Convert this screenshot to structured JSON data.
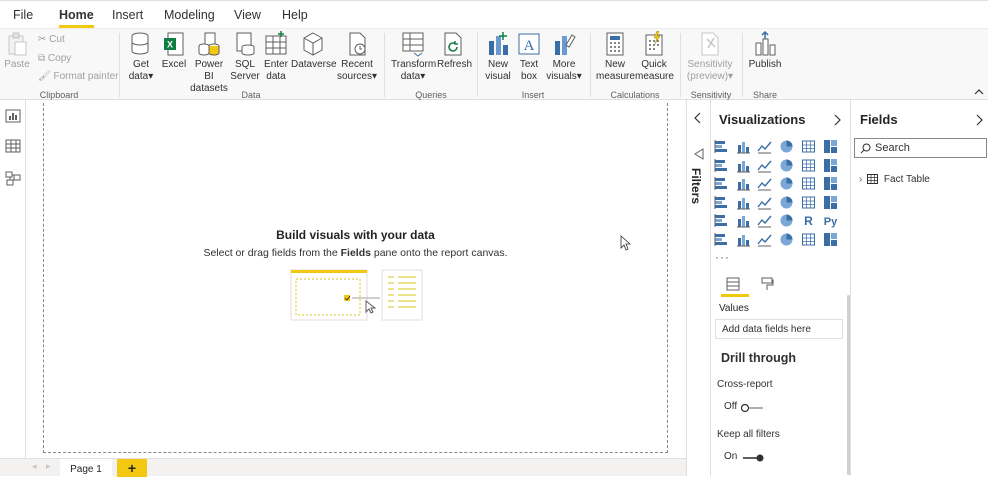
{
  "menu": {
    "items": [
      "File",
      "Home",
      "Insert",
      "Modeling",
      "View",
      "Help"
    ],
    "active": "Home"
  },
  "ribbon": {
    "clipboard": {
      "paste": "Paste",
      "cut": "Cut",
      "copy": "Copy",
      "format_painter": "Format painter",
      "group_label": "Clipboard"
    },
    "data": {
      "get_data_1": "Get",
      "get_data_2": "data",
      "excel": "Excel",
      "powerbi_1": "Power BI",
      "powerbi_2": "datasets",
      "sql_1": "SQL",
      "sql_2": "Server",
      "enter_1": "Enter",
      "enter_2": "data",
      "dataverse": "Dataverse",
      "recent_1": "Recent",
      "recent_2": "sources",
      "group_label": "Data"
    },
    "queries": {
      "transform_1": "Transform",
      "transform_2": "data",
      "refresh": "Refresh",
      "group_label": "Queries"
    },
    "insert": {
      "new_visual_1": "New",
      "new_visual_2": "visual",
      "text_box_1": "Text",
      "text_box_2": "box",
      "more_visuals_1": "More",
      "more_visuals_2": "visuals",
      "group_label": "Insert"
    },
    "calculations": {
      "new_measure_1": "New",
      "new_measure_2": "measure",
      "quick_measure_1": "Quick",
      "quick_measure_2": "measure",
      "group_label": "Calculations"
    },
    "sensitivity": {
      "label_1": "Sensitivity",
      "label_2": "(preview)",
      "group_label": "Sensitivity"
    },
    "share": {
      "publish": "Publish",
      "group_label": "Share"
    }
  },
  "canvas": {
    "title": "Build visuals with your data",
    "subtitle_pre": "Select or drag fields from the ",
    "subtitle_bold": "Fields",
    "subtitle_post": " pane onto the report canvas."
  },
  "pages": {
    "page1": "Page 1",
    "add": "+"
  },
  "filters": {
    "label": "Filters"
  },
  "visualizations": {
    "title": "Visualizations",
    "more": "···",
    "values_label": "Values",
    "values_placeholder": "Add data fields here",
    "drill_title": "Drill through",
    "cross_report_label": "Cross-report",
    "cross_report_state": "Off",
    "keep_filters_label": "Keep all filters",
    "keep_filters_state": "On"
  },
  "fields": {
    "title": "Fields",
    "search_placeholder": "Search",
    "table_name": "Fact Table"
  },
  "colors": {
    "accent": "#f2c811",
    "pbi_blue": "#3b6ea5",
    "border": "#e1dfdd"
  }
}
